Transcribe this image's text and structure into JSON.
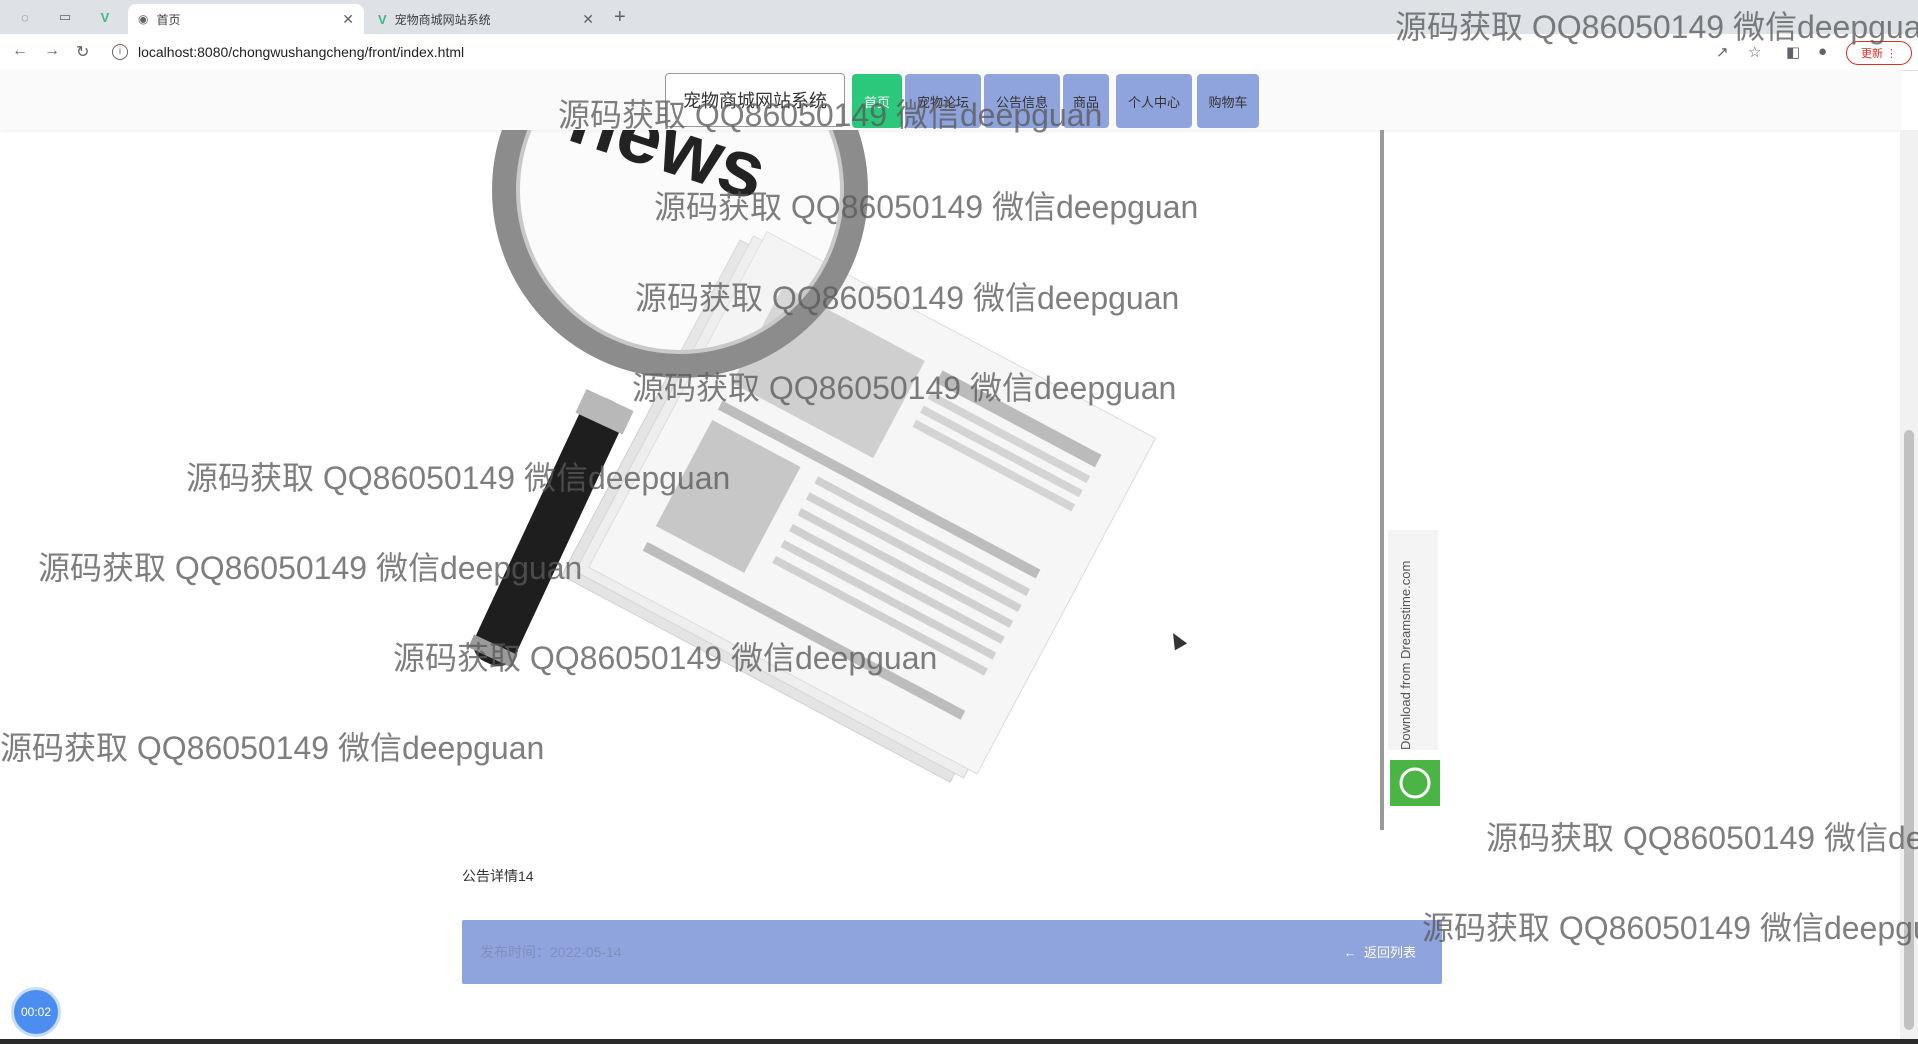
{
  "browser": {
    "tabs": [
      {
        "label": "首页",
        "active": true
      },
      {
        "label": "宠物商城网站系统",
        "active": false
      }
    ],
    "url": "localhost:8080/chongwushangcheng/front/index.html",
    "update_label": "更新"
  },
  "site": {
    "title": "宠物商城网站系统",
    "nav": [
      {
        "label": "首页",
        "active": true
      },
      {
        "label": "宠物论坛",
        "active": false
      },
      {
        "label": "公告信息",
        "active": false
      },
      {
        "label": "商品",
        "active": false
      },
      {
        "label": "个人中心",
        "active": false
      },
      {
        "label": "购物车",
        "active": false
      }
    ]
  },
  "content": {
    "title": "公告详情14",
    "detail_text": "发布时间：2022-05-14",
    "back_label": "返回列表"
  },
  "timer": "00:02",
  "watermark": "源码获取 QQ86050149 微信deepguan",
  "image_caption": "Download from Dreamstime.com"
}
